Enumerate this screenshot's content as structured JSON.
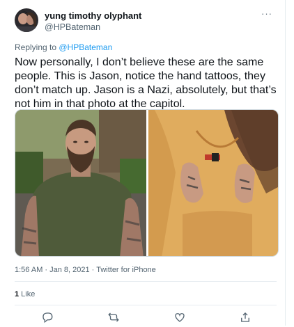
{
  "tweet": {
    "author_name": "yung timothy olyphant",
    "author_handle": "@HPBateman",
    "more_label": "···",
    "replying_prefix": "Replying to ",
    "replying_to": "@HPBateman",
    "text": "Now personally, I don’t believe these are the same people. This is Jason, notice the hand tattoos, they don’t match up. Jason is a Nazi, absolutely, but that’s not him in that photo at the capitol.",
    "timestamp": "1:56 AM · Jan 8, 2021 · Twitter for iPhone",
    "like_count": "1",
    "like_label": " Like"
  },
  "media": {
    "left_image": "photo of bearded man in green t-shirt",
    "right_image": "photo of person in yellow hoodie with tattooed hands"
  },
  "actions": [
    "reply-icon",
    "retweet-icon",
    "like-icon",
    "share-icon"
  ],
  "colors": {
    "accent": "#1d9bf0",
    "secondary_text": "#536471",
    "border": "#e6ecf0"
  }
}
